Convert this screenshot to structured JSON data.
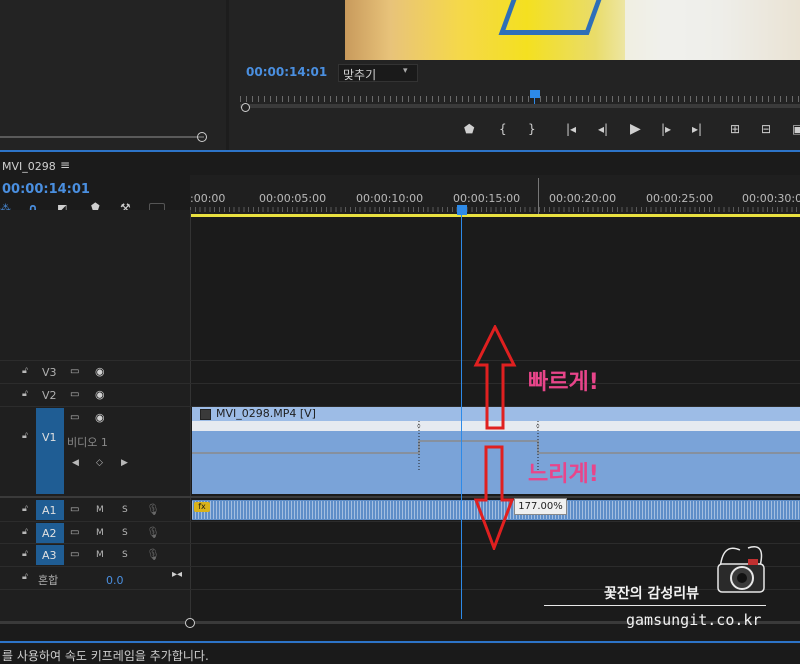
{
  "program_monitor": {
    "timecode": "00:00:14:01",
    "zoom_option": "맞추기"
  },
  "timeline": {
    "sequence_name": "MVI_0298",
    "timecode": "00:00:14:01",
    "ruler_labels": [
      ":00:00",
      "00:00:05:00",
      "00:00:10:00",
      "00:00:15:00",
      "00:00:20:00",
      "00:00:25:00",
      "00:00:30:00"
    ],
    "tracks": {
      "v3": "V3",
      "v2": "V2",
      "v1": "V1",
      "v1_name": "비디오 1",
      "a1": "A1",
      "a2": "A2",
      "a3": "A3",
      "mix_label": "혼합",
      "mix_value": "0.0",
      "m": "M",
      "s": "S"
    },
    "clip_name": "MVI_0298.MP4 [V]",
    "fx_badge": "fx",
    "speed_tooltip": "177.00%"
  },
  "annotations": {
    "faster": "빠르게!",
    "slower": "느리게!"
  },
  "watermark": {
    "name": "꽃잔의 감성리뷰",
    "url": "gamsungit.co.kr"
  },
  "status_bar": "를 사용하여 속도 키프레임을 추가합니다.",
  "colors": {
    "accent_blue": "#2d74c8",
    "annotation_pink": "#e8458a",
    "arrow_red": "#e02020",
    "clip_blue": "#7aa3d8"
  }
}
